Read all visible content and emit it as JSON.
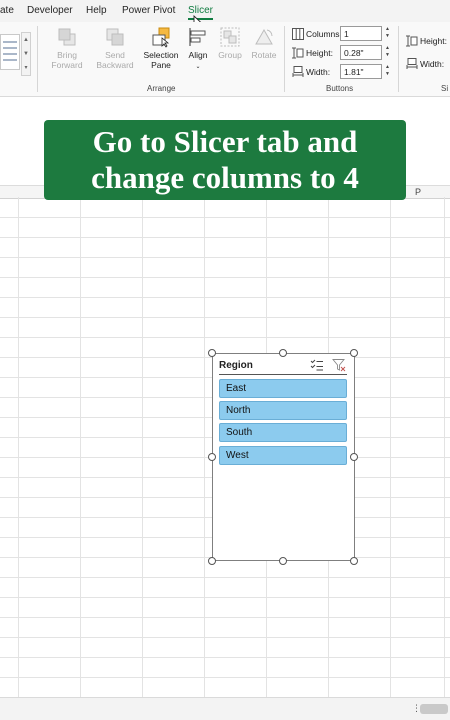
{
  "tabs": [
    {
      "label": "ate",
      "active": false
    },
    {
      "label": "Developer",
      "active": false
    },
    {
      "label": "Help",
      "active": false
    },
    {
      "label": "Power Pivot",
      "active": false
    },
    {
      "label": "Slicer",
      "active": true
    }
  ],
  "ribbon": {
    "arrange": {
      "label": "Arrange",
      "bring_forward": "Bring Forward",
      "send_backward": "Send Backward",
      "selection_pane": "Selection Pane",
      "align": "Align",
      "group": "Group",
      "rotate": "Rotate"
    },
    "buttons_group": {
      "label": "Buttons",
      "columns_label": "Columns:",
      "columns_value": "1",
      "height_label": "Height:",
      "height_value": "0.28\"",
      "width_label": "Width:",
      "width_value": "1.81\""
    },
    "size_group": {
      "height_label": "Height:",
      "width_label": "Width:",
      "label_partial": "Si"
    }
  },
  "banner": {
    "line1": "Go to Slicer tab and",
    "line2": "change columns to 4"
  },
  "sheet": {
    "visible_column": "P"
  },
  "slicer": {
    "title": "Region",
    "items": [
      "East",
      "North",
      "South",
      "West"
    ]
  },
  "colors": {
    "accent_green": "#107c41",
    "banner_green": "#1d7a3f",
    "slicer_item": "#8ccbee"
  }
}
